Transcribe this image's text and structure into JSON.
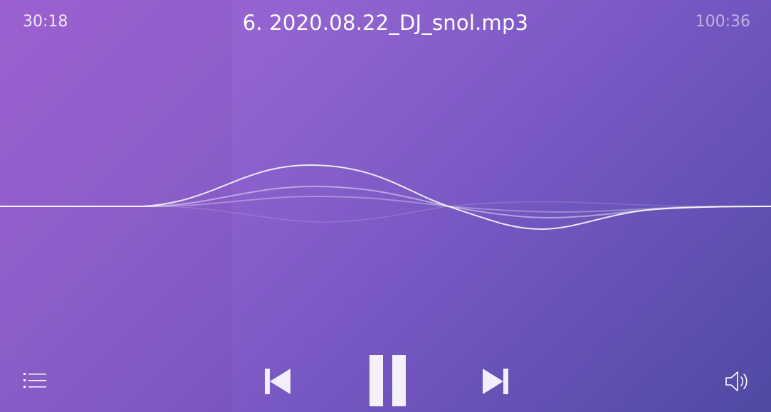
{
  "player": {
    "track_title": "6. 2020.08.22_DJ_snol.mp3",
    "elapsed_time": "30:18",
    "total_time": "100:36",
    "progress_fraction": 0.3012
  },
  "controls": {
    "playlist_icon": "playlist-icon",
    "prev_icon": "skip-previous-icon",
    "pause_icon": "pause-icon",
    "next_icon": "skip-next-icon",
    "volume_icon": "volume-icon"
  },
  "colors": {
    "gradient_start": "#a466d8",
    "gradient_end": "#4f4aa2",
    "foreground": "#ffffff"
  }
}
